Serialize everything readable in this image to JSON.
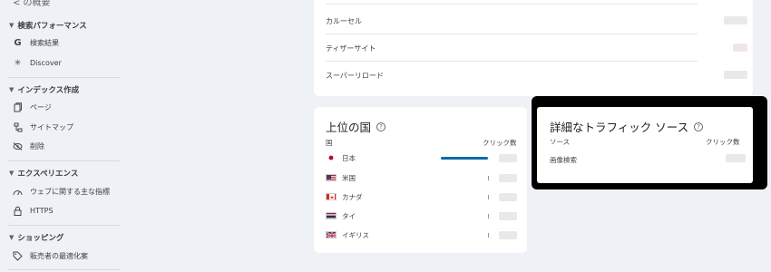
{
  "sidebar": {
    "back_label": "< の概要",
    "sections": [
      {
        "title": "検索パフォーマンス",
        "items": [
          {
            "label": "検索結果",
            "icon": "google-g-icon"
          },
          {
            "label": "Discover",
            "icon": "asterisk-icon"
          }
        ]
      },
      {
        "title": "インデックス作成",
        "items": [
          {
            "label": "ページ",
            "icon": "pages-icon"
          },
          {
            "label": "サイトマップ",
            "icon": "sitemap-icon"
          },
          {
            "label": "削除",
            "icon": "eye-off-icon"
          }
        ]
      },
      {
        "title": "エクスペリエンス",
        "items": [
          {
            "label": "ウェブに関する主な指標",
            "icon": "gauge-icon"
          },
          {
            "label": "HTTPS",
            "icon": "lock-icon"
          }
        ]
      },
      {
        "title": "ショッピング",
        "items": [
          {
            "label": "販売者の最適化案",
            "icon": "tag-icon"
          }
        ]
      }
    ]
  },
  "top_card": {
    "rows": [
      "カルーセル",
      "ティザーサイト",
      "スーパーリロード"
    ]
  },
  "country_card": {
    "title": "上位の国",
    "col_country": "国",
    "col_clicks": "クリック数",
    "countries": [
      {
        "name": "日本",
        "flag": "jp",
        "bar_fraction": 0.97
      },
      {
        "name": "米国",
        "flag": "us",
        "bar_fraction": 0
      },
      {
        "name": "カナダ",
        "flag": "ca",
        "bar_fraction": 0
      },
      {
        "name": "タイ",
        "flag": "th",
        "bar_fraction": 0
      },
      {
        "name": "イギリス",
        "flag": "uk",
        "bar_fraction": 0
      }
    ]
  },
  "traffic_card": {
    "title": "詳細なトラフィック ソース",
    "col_source": "ソース",
    "col_clicks": "クリック数",
    "rows": [
      {
        "source": "画像検索"
      }
    ]
  },
  "colors": {
    "accent": "#0b6aa6",
    "highlight_border": "#000000",
    "background": "#eef1f6"
  }
}
